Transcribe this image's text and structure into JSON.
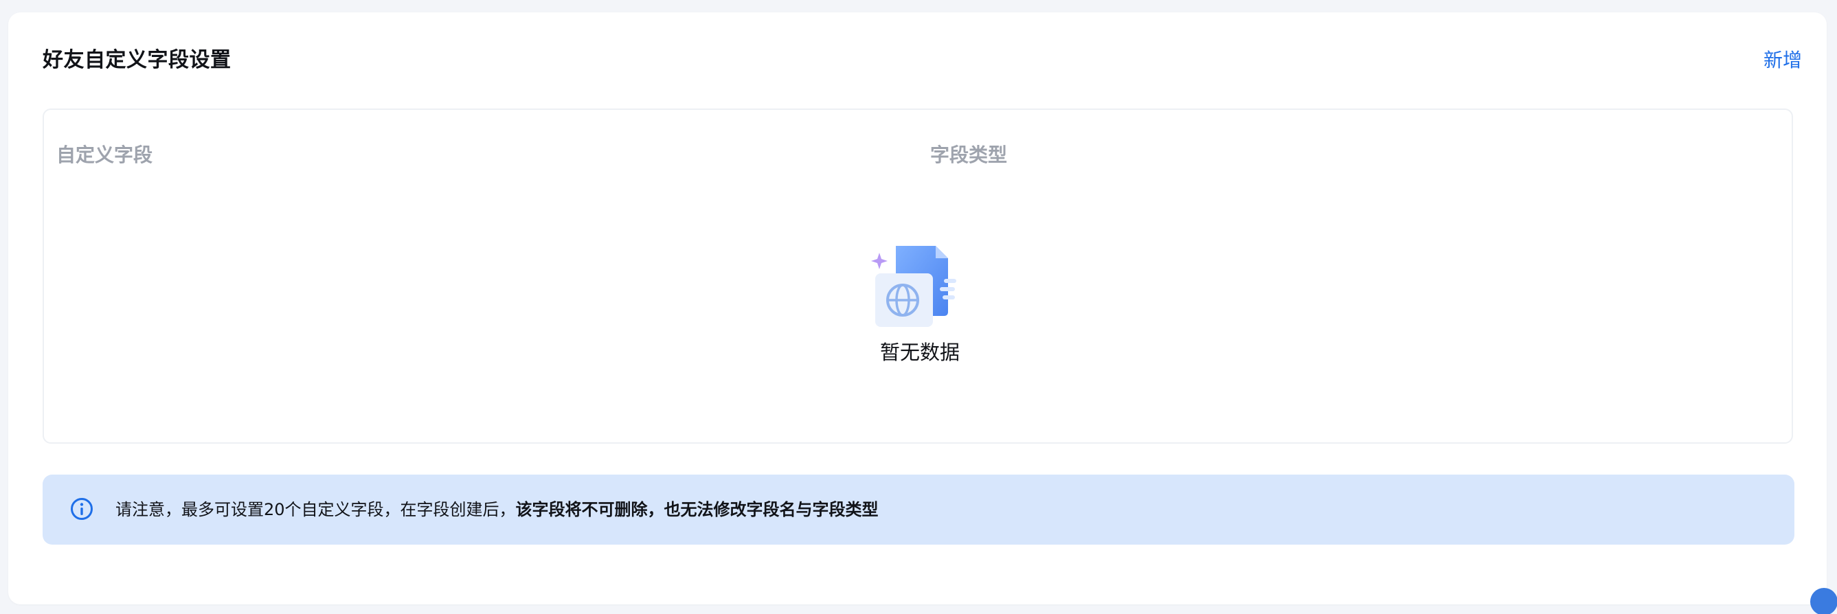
{
  "header": {
    "title": "好友自定义字段设置",
    "add_label": "新增"
  },
  "table": {
    "columns": [
      {
        "label": "自定义字段"
      },
      {
        "label": "字段类型"
      }
    ],
    "empty": {
      "text": "暂无数据",
      "icon": "empty-document-globe-icon"
    }
  },
  "notice": {
    "icon": "info-icon",
    "text_normal": "请注意，最多可设置20个自定义字段，在字段创建后，",
    "text_bold": "该字段将不可删除，也无法修改字段名与字段类型"
  },
  "colors": {
    "accent": "#1f6fe8",
    "notice_bg": "#d7e6fc",
    "header_text": "#9ea3ad"
  }
}
